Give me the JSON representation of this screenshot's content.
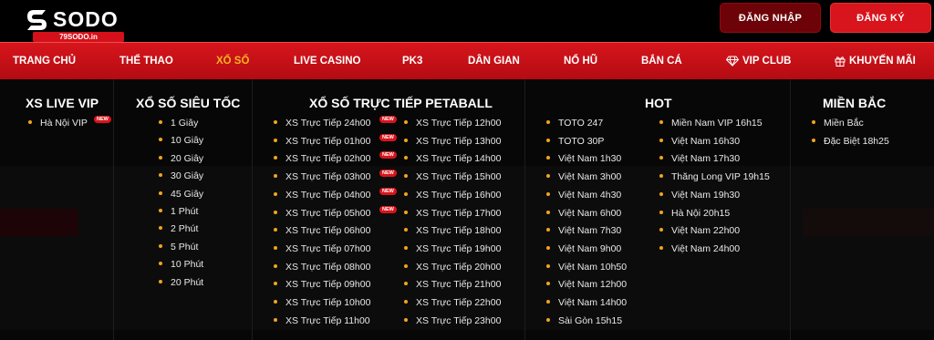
{
  "header": {
    "logo_text": "SODO",
    "logo_sub": "79SODO.in",
    "login_label": "ĐĂNG NHẬP",
    "register_label": "ĐĂNG KÝ"
  },
  "nav": {
    "items": [
      {
        "label": "TRANG CHỦ"
      },
      {
        "label": "THỂ THAO"
      },
      {
        "label": "XỔ SỐ"
      },
      {
        "label": "LIVE CASINO"
      },
      {
        "label": "PK3"
      },
      {
        "label": "DÂN GIAN"
      },
      {
        "label": "NỔ HŨ"
      },
      {
        "label": "BẮN CÁ"
      },
      {
        "label": "VIP CLUB",
        "icon": "diamond-icon"
      },
      {
        "label": "KHUYẾN MÃI",
        "icon": "gift-icon"
      }
    ],
    "active_index": 2
  },
  "badge_label": "NEW",
  "menu": {
    "xs_live_vip": {
      "title": "XS LIVE VIP",
      "items": [
        {
          "label": "Hà Nội VIP",
          "new": true
        }
      ]
    },
    "sieu_toc": {
      "title": "XỔ SỐ SIÊU TỐC",
      "items": [
        "1 Giây",
        "10 Giây",
        "20 Giây",
        "30 Giây",
        "45 Giây",
        "1 Phút",
        "2 Phút",
        "5 Phút",
        "10 Phút",
        "20 Phút"
      ]
    },
    "petaball": {
      "title": "XỔ SỐ TRỰC TIẾP PETABALL",
      "col1": [
        {
          "label": "XS Trực Tiếp 24h00",
          "new": true
        },
        {
          "label": "XS Trực Tiếp 01h00",
          "new": true
        },
        {
          "label": "XS Trực Tiếp 02h00",
          "new": true
        },
        {
          "label": "XS Trực Tiếp 03h00",
          "new": true
        },
        {
          "label": "XS Trực Tiếp 04h00",
          "new": true
        },
        {
          "label": "XS Trực Tiếp 05h00",
          "new": true
        },
        {
          "label": "XS Trực Tiếp 06h00"
        },
        {
          "label": "XS Trực Tiếp 07h00"
        },
        {
          "label": "XS Trực Tiếp 08h00"
        },
        {
          "label": "XS Trực Tiếp 09h00"
        },
        {
          "label": "XS Trực Tiếp 10h00"
        },
        {
          "label": "XS Trực Tiếp 11h00"
        }
      ],
      "col2": [
        {
          "label": "XS Trực Tiếp 12h00"
        },
        {
          "label": "XS Trực Tiếp 13h00"
        },
        {
          "label": "XS Trực Tiếp 14h00"
        },
        {
          "label": "XS Trực Tiếp 15h00"
        },
        {
          "label": "XS Trực Tiếp 16h00"
        },
        {
          "label": "XS Trực Tiếp 17h00"
        },
        {
          "label": "XS Trực Tiếp 18h00"
        },
        {
          "label": "XS Trực Tiếp 19h00"
        },
        {
          "label": "XS Trực Tiếp 20h00"
        },
        {
          "label": "XS Trực Tiếp 21h00"
        },
        {
          "label": "XS Trực Tiếp 22h00"
        },
        {
          "label": "XS Trực Tiếp 23h00"
        }
      ]
    },
    "hot": {
      "title": "HOT",
      "col1": [
        "TOTO 247",
        "TOTO 30P",
        "Việt Nam 1h30",
        "Việt Nam 3h00",
        "Việt Nam 4h30",
        "Việt Nam 6h00",
        "Việt Nam 7h30",
        "Việt Nam 9h00",
        "Việt Nam 10h50",
        "Việt Nam 12h00",
        "Việt Nam 14h00",
        "Sài Gòn 15h15"
      ],
      "col2": [
        "Miền Nam VIP 16h15",
        "Việt Nam 16h30",
        "Việt Nam 17h30",
        "Thăng Long VIP 19h15",
        "Việt Nam 19h30",
        "Hà Nội 20h15",
        "Việt Nam 22h00",
        "Việt Nam 24h00"
      ]
    },
    "mien_bac": {
      "title": "MIỀN BẮC",
      "items": [
        "Miền Bắc",
        "Đặc Biệt 18h25"
      ]
    }
  },
  "colors": {
    "brand_red": "#d8141c",
    "dark_red": "#6d0309",
    "active_gold": "#f7b426",
    "bullet_orange": "#f2a51b"
  }
}
